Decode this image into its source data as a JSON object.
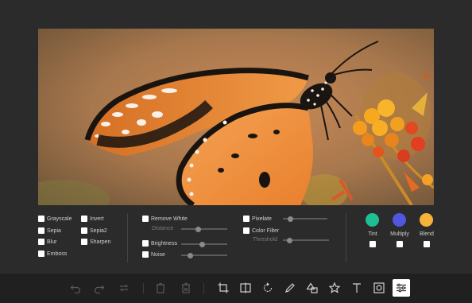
{
  "image": {
    "subject": "butterfly-on-flowers"
  },
  "filters": {
    "col1": [
      "Grayscale",
      "Sepia",
      "Blur",
      "Emboss"
    ],
    "col2": [
      "Invert",
      "Sepia2",
      "Sharpen"
    ],
    "remove_white": "Remove White",
    "distance": "Distance",
    "brightness": "Brightness",
    "noise": "Noise",
    "pixelate": "Pixelate",
    "color_filter": "Color Filter",
    "threshold": "Threshold",
    "sliders": {
      "distance": 0.35,
      "brightness": 0.45,
      "noise": 0.15,
      "pixelate": 0.12,
      "threshold": 0.1
    }
  },
  "blend": {
    "tint": {
      "label": "Tint",
      "color": "#1fbf96"
    },
    "multiply": {
      "label": "Multiply",
      "color": "#5156e0"
    },
    "blend": {
      "label": "Blend",
      "color": "#f6b33a"
    }
  },
  "toolbar": {
    "icons": [
      "undo-icon",
      "redo-icon",
      "reset-icon",
      "delete-icon",
      "delete-all-icon",
      "crop-icon",
      "flip-icon",
      "rotate-icon",
      "draw-icon",
      "shape-icon",
      "icon-icon",
      "text-icon",
      "mask-icon",
      "filter-icon"
    ],
    "active": "filter-icon"
  }
}
